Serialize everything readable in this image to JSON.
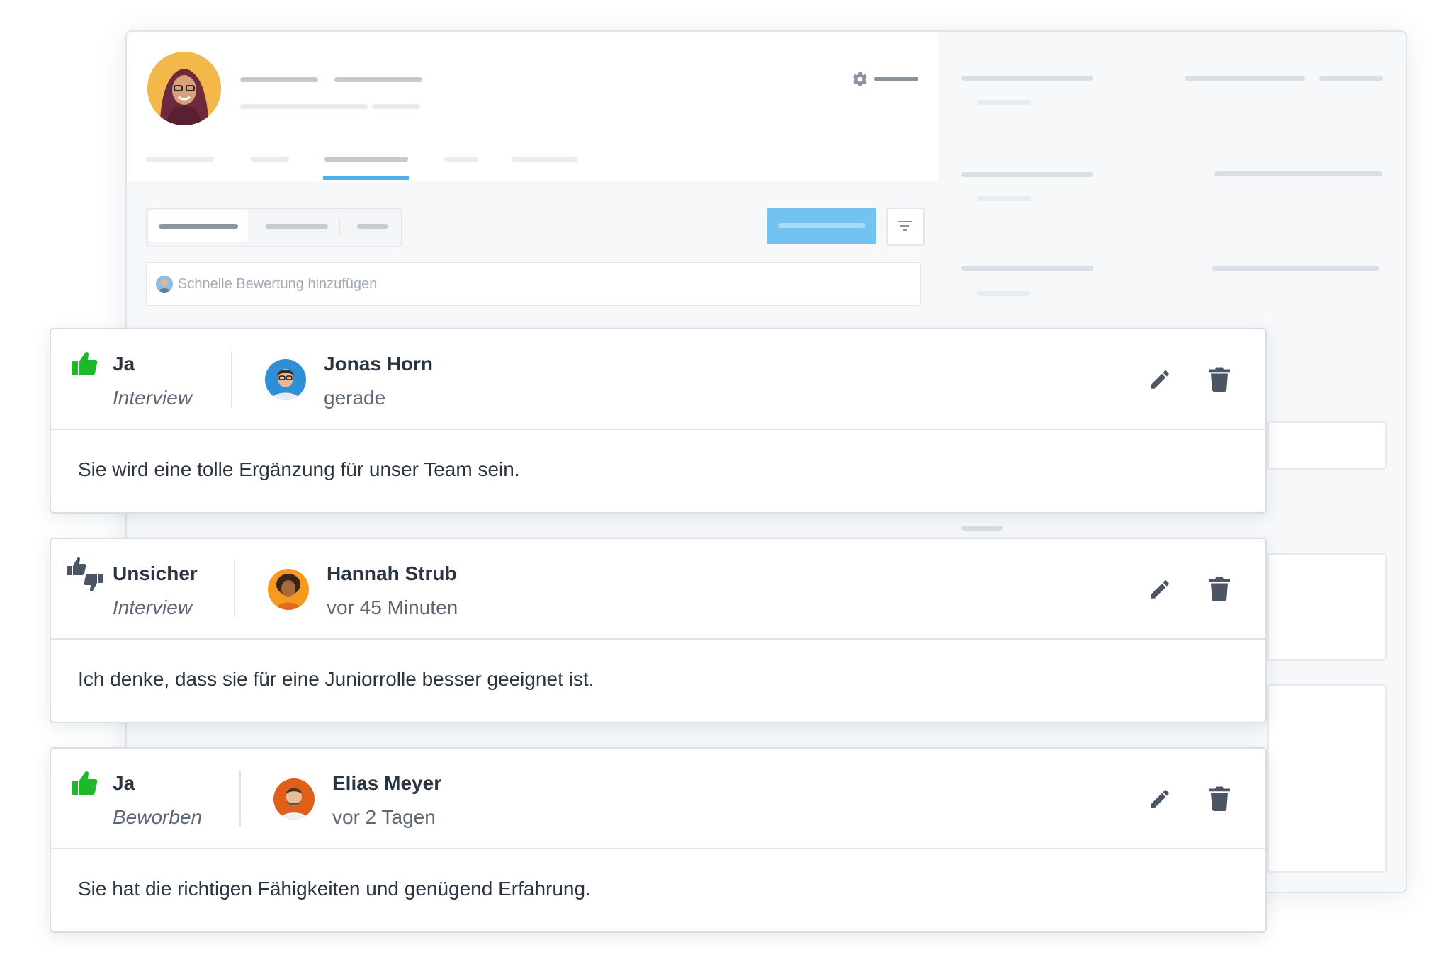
{
  "quick_review": {
    "placeholder": "Schnelle Bewertung hinzufügen"
  },
  "colors": {
    "accent": "#52aee8",
    "positive": "#1fb82d",
    "neutral": "#4b5563"
  },
  "feedback": [
    {
      "verdict": "Ja",
      "verdict_icon": "thumbs-up-icon",
      "stage": "Interview",
      "reviewer": "Jonas Horn",
      "time": "gerade",
      "comment": "Sie wird eine tolle Ergänzung für unser Team sein."
    },
    {
      "verdict": "Unsicher",
      "verdict_icon": "thumbs-up-down-icon",
      "stage": "Interview",
      "reviewer": "Hannah Strub",
      "time": "vor 45 Minuten",
      "comment": "Ich denke, dass sie für eine Juniorrolle besser geeignet ist."
    },
    {
      "verdict": "Ja",
      "verdict_icon": "thumbs-up-icon",
      "stage": "Beworben",
      "reviewer": "Elias Meyer",
      "time": "vor 2 Tagen",
      "comment": "Sie hat die richtigen Fähigkeiten und genügend Erfahrung."
    }
  ]
}
